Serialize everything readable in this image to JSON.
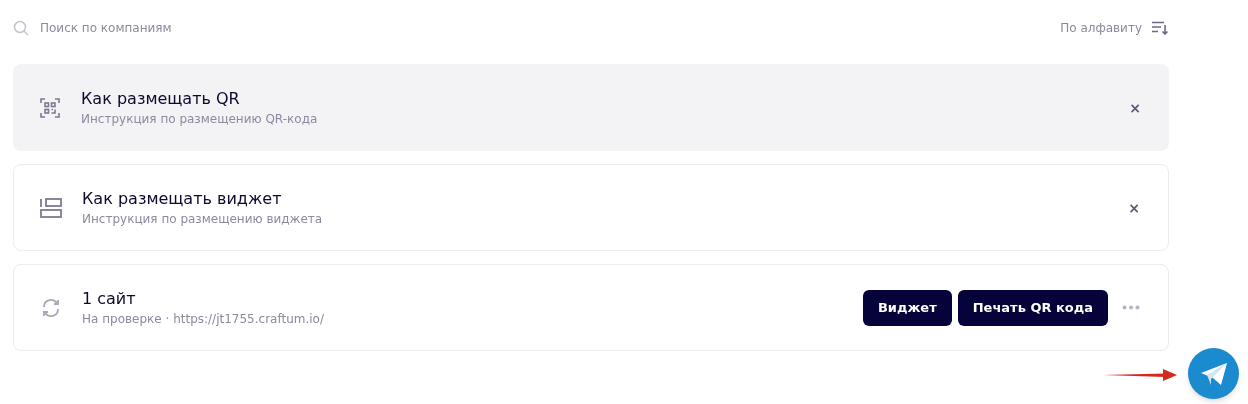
{
  "search": {
    "placeholder": "Поиск по компаниям"
  },
  "sort": {
    "label": "По алфавиту"
  },
  "cards": [
    {
      "kind": "qr-guide",
      "highlighted": true,
      "title": "Как размещать QR",
      "subtitle": "Инструкция по размещению QR-кода",
      "close": "×"
    },
    {
      "kind": "widget-guide",
      "highlighted": false,
      "title": "Как размещать виджет",
      "subtitle": "Инструкция по размещению виджета",
      "close": "×"
    },
    {
      "kind": "site",
      "highlighted": false,
      "title": "1 сайт",
      "subtitle": "На проверке · https://jt1755.craftum.io/",
      "buttons": [
        "Виджет",
        "Печать QR кода"
      ]
    }
  ]
}
